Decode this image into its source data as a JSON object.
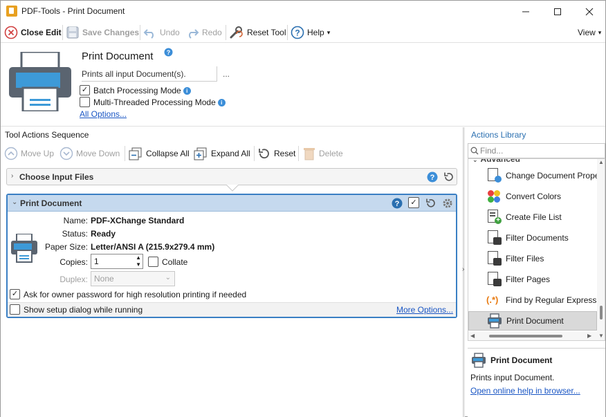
{
  "window": {
    "title": "PDF-Tools - Print Document",
    "minimize_icon": "minimize-icon",
    "maximize_icon": "maximize-icon",
    "close_icon": "close-icon"
  },
  "toolbar": {
    "close_edit": "Close Edit",
    "save_changes": "Save Changes",
    "undo": "Undo",
    "redo": "Redo",
    "reset_tool": "Reset Tool",
    "help": "Help",
    "view": "View"
  },
  "tool": {
    "title": "Print Document",
    "description": "Prints all input Document(s).",
    "more_dots": "...",
    "batch_mode_label": "Batch Processing Mode",
    "batch_mode_checked": true,
    "multithread_label": "Multi-Threaded Processing Mode",
    "multithread_checked": false,
    "all_options": "All Options..."
  },
  "sequence": {
    "header": "Tool Actions Sequence",
    "move_up": "Move Up",
    "move_down": "Move Down",
    "collapse_all": "Collapse All",
    "expand_all": "Expand All",
    "reset": "Reset",
    "delete": "Delete",
    "collapsed_card_title": "Choose Input Files",
    "open_card_title": "Print Document",
    "props": {
      "name_label": "Name:",
      "name_value": "PDF-XChange Standard",
      "status_label": "Status:",
      "status_value": "Ready",
      "paper_label": "Paper Size:",
      "paper_value": "Letter/ANSI A (215.9x279.4 mm)",
      "copies_label": "Copies:",
      "copies_value": "1",
      "collate_label": "Collate",
      "duplex_label": "Duplex:",
      "duplex_value": "None"
    },
    "ask_password_label": "Ask for owner password for high resolution printing if needed",
    "ask_password_checked": true,
    "show_setup_label": "Show setup dialog while running",
    "show_setup_checked": false,
    "more_options": "More Options..."
  },
  "library": {
    "header": "Actions Library",
    "search_placeholder": "Find...",
    "group_label": "Advanced",
    "items": [
      "Change Document Properties",
      "Convert Colors",
      "Create File List",
      "Filter Documents",
      "Filter Files",
      "Filter Pages",
      "Find by Regular Expression",
      "Print Document"
    ],
    "selected_index": 7,
    "detail_title": "Print Document",
    "detail_desc": "Prints input Document.",
    "detail_link": "Open online help in browser..."
  },
  "colors": {
    "accent": "#3a7fc4",
    "card_header": "#c5d9ee",
    "link": "#1a56c4",
    "selected_item": "#d9d9d9"
  }
}
